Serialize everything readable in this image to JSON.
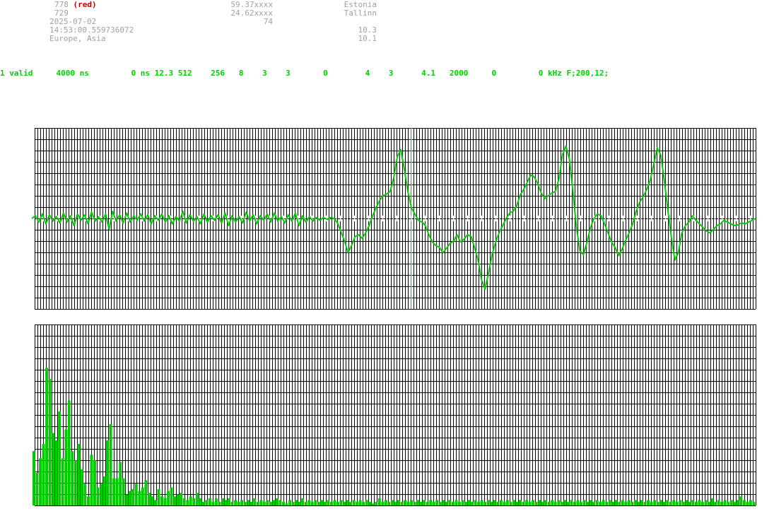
{
  "header": {
    "id_a": "778",
    "id_a_tag": "(red)",
    "id_b": "729",
    "date": "2025-07-02",
    "time": "14:53:00.559736072",
    "region": "Europe, Asia",
    "lat": "59.37xxxx",
    "lon": "24.62xxxx",
    "mid_val": "74",
    "country": "Estonia",
    "city": "Tallinn",
    "val1": "10.3",
    "val2": "10.1"
  },
  "status": {
    "valid": "1 valid",
    "period": "4000 ns",
    "offset": "0 ns",
    "f1": "12.3",
    "f2": "512",
    "f3": "256",
    "f4": "8",
    "f5": "3",
    "f6": "3",
    "f7": "0",
    "f8": "4",
    "f9": "3",
    "f10": "4.1",
    "f11": "2000",
    "f12": "0",
    "f13": "0 kHz",
    "f14": "F;200,12;"
  },
  "colors": {
    "trace": "#00cc00",
    "bars": "#00cc00",
    "grid": "#000000",
    "marker": "#99ee99",
    "header_text": "#a0a0a0",
    "tag": "#c00000",
    "status_text": "#00d000"
  },
  "chart_data": [
    {
      "type": "line",
      "title": "",
      "series": [
        {
          "values": [
            0,
            0.3,
            -0.4,
            0.5,
            -0.6,
            0.4,
            -0.3,
            0.2,
            -0.5,
            0.6,
            -0.4,
            0.3,
            -0.8,
            0.5,
            -0.2,
            0.4,
            -0.6,
            0.7,
            -0.3,
            0.2,
            -0.4,
            0.5,
            -1.2,
            0.8,
            -0.3,
            0.4,
            -0.5,
            0.6,
            -0.4,
            0.3,
            -0.2,
            0.5,
            -0.3,
            0.4,
            -0.6,
            0.3,
            -0.2,
            0.5,
            -0.4,
            0.3,
            -0.6,
            0.2,
            -0.3,
            0.8,
            -0.5,
            0.4,
            -0.3,
            0.2,
            -0.6,
            0.5,
            -0.4,
            0.3,
            -0.2,
            0.4,
            -0.5,
            0.6,
            -0.8,
            0.3,
            -0.4,
            0.2,
            -0.5,
            0.7,
            -0.3,
            0.4,
            -0.6,
            0.3,
            -0.2,
            0.5,
            -0.4,
            0.6,
            -0.3,
            0.2,
            -0.5,
            0.4,
            -0.3,
            0.6,
            -0.8,
            0.3,
            -0.4,
            0.2,
            -0.3,
            0.1,
            -0.2,
            0.1,
            -0.1,
            0.1,
            0,
            -0.5,
            -1.5,
            -2.5,
            -3.8,
            -3.0,
            -2.0,
            -1.8,
            -2.2,
            -1.6,
            -0.8,
            0.3,
            1.2,
            2.0,
            2.5,
            2.7,
            3.0,
            4.5,
            6.8,
            7.6,
            5.5,
            3.0,
            1.2,
            0.5,
            -0.2,
            -0.4,
            -0.8,
            -1.8,
            -2.6,
            -3.0,
            -3.2,
            -3.8,
            -3.3,
            -2.8,
            -2.5,
            -1.8,
            -2.6,
            -2.3,
            -1.8,
            -2.0,
            -3.2,
            -4.6,
            -6.8,
            -7.8,
            -6.0,
            -4.0,
            -2.6,
            -1.6,
            -0.8,
            0,
            0.6,
            0.8,
            1.4,
            2.6,
            3.2,
            4.0,
            4.8,
            4.6,
            3.8,
            2.8,
            2.2,
            2.5,
            2.8,
            3.0,
            4.3,
            7.0,
            8.0,
            6.6,
            3.0,
            -1.0,
            -3.6,
            -4.0,
            -2.6,
            -1.0,
            0,
            0.5,
            0.3,
            -0.6,
            -1.6,
            -2.6,
            -3.2,
            -4.1,
            -3.4,
            -2.4,
            -1.6,
            -0.6,
            0.8,
            1.8,
            2.4,
            3.2,
            4.2,
            6.0,
            7.8,
            7.0,
            4.2,
            1.0,
            -2.0,
            -4.6,
            -3.8,
            -1.6,
            -0.8,
            -0.4,
            0.3,
            -0.2,
            -0.6,
            -1.0,
            -1.4,
            -1.6,
            -1.2,
            -0.8,
            -0.6,
            -0.2,
            -0.4,
            -0.6,
            -0.8,
            -0.7,
            -0.5,
            -0.6,
            -0.4,
            -0.2,
            0
          ]
        }
      ],
      "ylim": [
        -10,
        10
      ],
      "grid": true,
      "marker_index": 108
    },
    {
      "type": "bar",
      "title": "",
      "values": [
        3,
        1.8,
        2.6,
        3.4,
        7.6,
        7.0,
        4.0,
        3.6,
        5.2,
        2.6,
        4.2,
        5.8,
        3.0,
        2.5,
        3.4,
        2.0,
        1.2,
        0.5,
        2.8,
        2.5,
        1.0,
        1.2,
        1.6,
        3.6,
        4.5,
        1.5,
        1.5,
        2.4,
        1.5,
        0.6,
        0.8,
        0.9,
        1.2,
        0.8,
        1.0,
        1.4,
        0.7,
        0.5,
        0.3,
        0.9,
        0.5,
        0.4,
        0.8,
        1.0,
        0.5,
        0.6,
        0.7,
        0.4,
        0.3,
        0.5,
        0.4,
        0.7,
        0.4,
        0.2,
        0.3,
        0.4,
        0.2,
        0.4,
        0.2,
        0.4,
        0.3,
        0.4,
        0.2,
        0.3,
        0.2,
        0.3,
        0.2,
        0.3,
        0.2,
        0.4,
        0.2,
        0.3,
        0.2,
        0.3,
        0.2,
        0.3,
        0.4,
        0.3,
        0.2,
        0.1,
        0.3,
        0.2,
        0.3,
        0.2,
        0.4,
        0.2,
        0.3,
        0.2,
        0.3,
        0.2,
        0.3,
        0.2,
        0.3,
        0.2,
        0.3,
        0.2,
        0.3,
        0.2,
        0.3,
        0.2,
        0.3,
        0.2,
        0.3,
        0.2,
        0.3,
        0.2,
        0.1,
        0.2,
        0.4,
        0.2,
        0.3,
        0.2,
        0.3,
        0.2,
        0.3,
        0.2,
        0.3,
        0.2,
        0.3,
        0.2,
        0.3,
        0.2,
        0.3,
        0.2,
        0.3,
        0.2,
        0.3,
        0.2,
        0.3,
        0.2,
        0.3,
        0.2,
        0.3,
        0.2,
        0.3,
        0.2,
        0.3,
        0.2,
        0.3,
        0.2,
        0.3,
        0.2,
        0.3,
        0.2,
        0.3,
        0.2,
        0.3,
        0.2,
        0.3,
        0.2,
        0.3,
        0.2,
        0.3,
        0.2,
        0.3,
        0.2,
        0.3,
        0.2,
        0.3,
        0.2,
        0.3,
        0.2,
        0.3,
        0.2,
        0.3,
        0.2,
        0.3,
        0.2,
        0.3,
        0.2,
        0.3,
        0.2,
        0.3,
        0.2,
        0.3,
        0.2,
        0.3,
        0.2,
        0.3,
        0.2,
        0.3,
        0.2,
        0.3,
        0.2,
        0.3,
        0.2,
        0.3,
        0.2,
        0.3,
        0.2,
        0.3,
        0.2,
        0.3,
        0.2,
        0.3,
        0.2,
        0.3,
        0.2,
        0.3,
        0.2,
        0.3,
        0.2,
        0.3,
        0.2,
        0.3,
        0.2,
        0.3,
        0.2,
        0.3,
        0.2,
        0.3,
        0.2,
        0.4,
        0.2,
        0.3,
        0.2,
        0.3,
        0.2,
        0.3,
        0.2,
        0.3,
        0.5,
        0.3,
        0.2,
        0.3,
        0.2
      ],
      "ylim": [
        0,
        10
      ],
      "grid": true
    }
  ]
}
